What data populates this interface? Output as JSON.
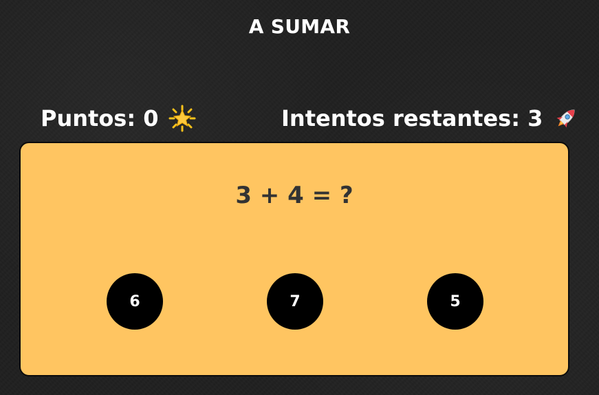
{
  "header": {
    "title": "A SUMAR"
  },
  "stats": {
    "score_label": "Puntos:",
    "score_value": "0",
    "score_icon": "glowing-star-icon",
    "attempts_label": "Intentos restantes:",
    "attempts_value": "3",
    "attempts_icon": "rocket-icon"
  },
  "question": {
    "text": "3 + 4 = ?"
  },
  "answers": [
    {
      "label": "6"
    },
    {
      "label": "7"
    },
    {
      "label": "5"
    }
  ],
  "colors": {
    "background": "#1f1f1f",
    "panel": "#ffc561",
    "question_text": "#333333",
    "answer_bubble": "#000000",
    "answer_text": "#ffffff",
    "text": "#ffffff"
  }
}
